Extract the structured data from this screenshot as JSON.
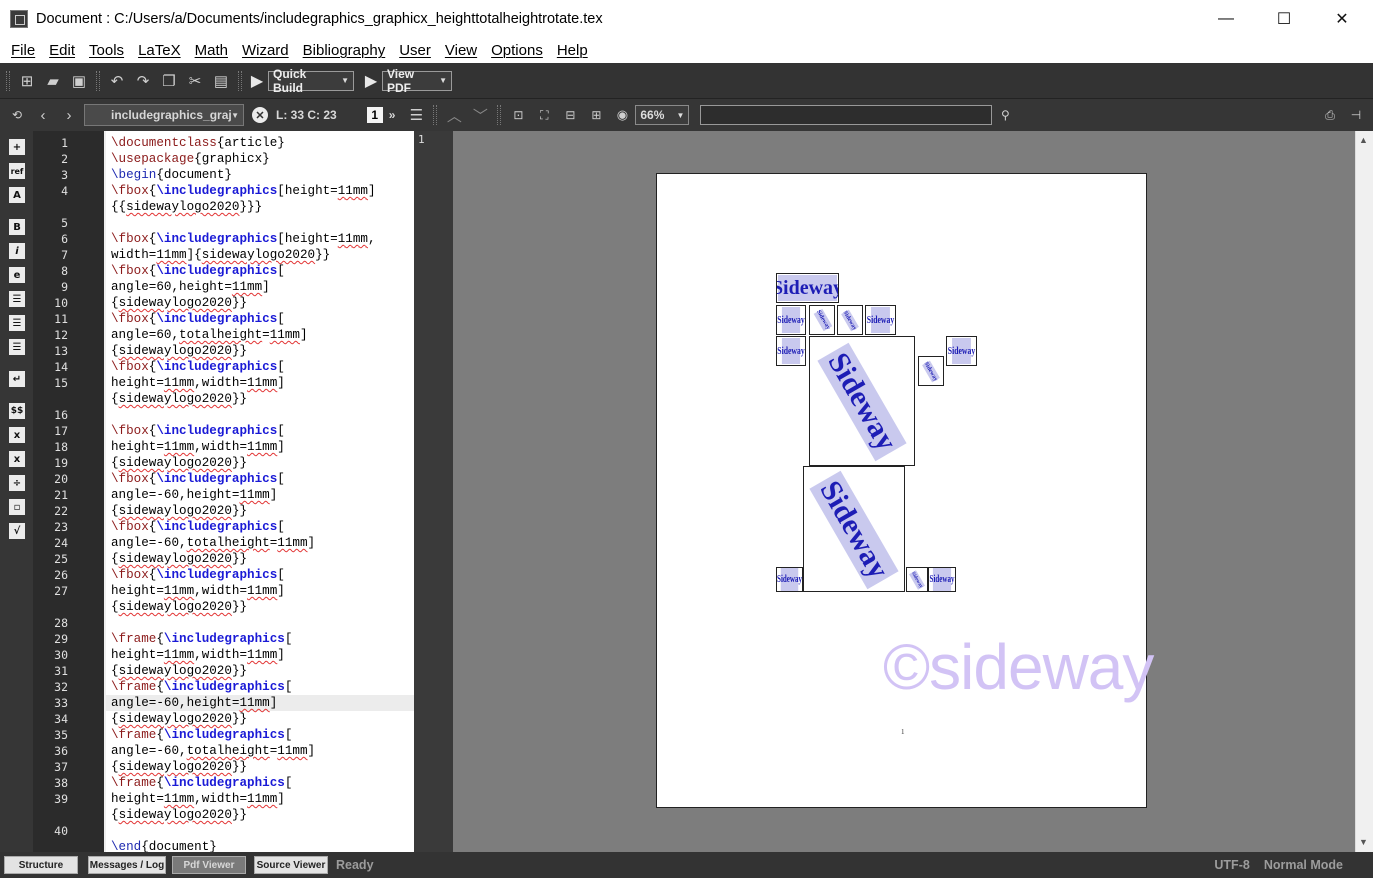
{
  "window": {
    "title": "Document : C:/Users/a/Documents/includegraphics_graphicx_heighttotalheightrotate.tex",
    "minimize": "—",
    "maximize": "☐",
    "close": "✕"
  },
  "menu": [
    "File",
    "Edit",
    "Tools",
    "LaTeX",
    "Math",
    "Wizard",
    "Bibliography",
    "User",
    "View",
    "Options",
    "Help"
  ],
  "toolbar": {
    "quick_build": "Quick Build",
    "view_pdf": "View PDF"
  },
  "toolbar2": {
    "file_tab": "includegraphics_graj",
    "cursor_pos": "L: 33 C: 23",
    "page_num": "1",
    "more": "»",
    "zoom": "66%"
  },
  "editor": {
    "line_numbers": [
      "1",
      "2",
      "3",
      "4",
      "5",
      "6",
      "7",
      "8",
      "9",
      "10",
      "11",
      "12",
      "13",
      "14",
      "15",
      "16",
      "17",
      "18",
      "19",
      "20",
      "21",
      "22",
      "23",
      "24",
      "25",
      "26",
      "27",
      "28",
      "29",
      "30",
      "31",
      "32",
      "33",
      "34",
      "35",
      "36",
      "37",
      "38",
      "39",
      "40"
    ]
  },
  "viewer": {
    "page_marker": "1",
    "logo_text": "Sideway",
    "watermark": "©sideway",
    "page_footer": "1"
  },
  "leftbar": {
    "icons": [
      "insert-icon",
      "ref",
      "label-icon",
      "B",
      "i",
      "e",
      "align-left-icon",
      "align-center-icon",
      "align-right-icon",
      "newline-icon",
      "$$",
      "sub",
      "sup",
      "frac",
      "dfrac",
      "sqrt"
    ]
  },
  "status": {
    "tabs": [
      "Structure",
      "Messages / Log",
      "Pdf Viewer",
      "Source Viewer"
    ],
    "active_tab": "Pdf Viewer",
    "state": "Ready",
    "encoding": "UTF-8",
    "mode": "Normal Mode"
  },
  "colors": {
    "dark_bg": "#333333",
    "latex_command": "#8b1a1a",
    "latex_keyword": "#1a1ad6",
    "logo_fill": "#c9c9ee",
    "watermark": "#d2c3f5"
  }
}
